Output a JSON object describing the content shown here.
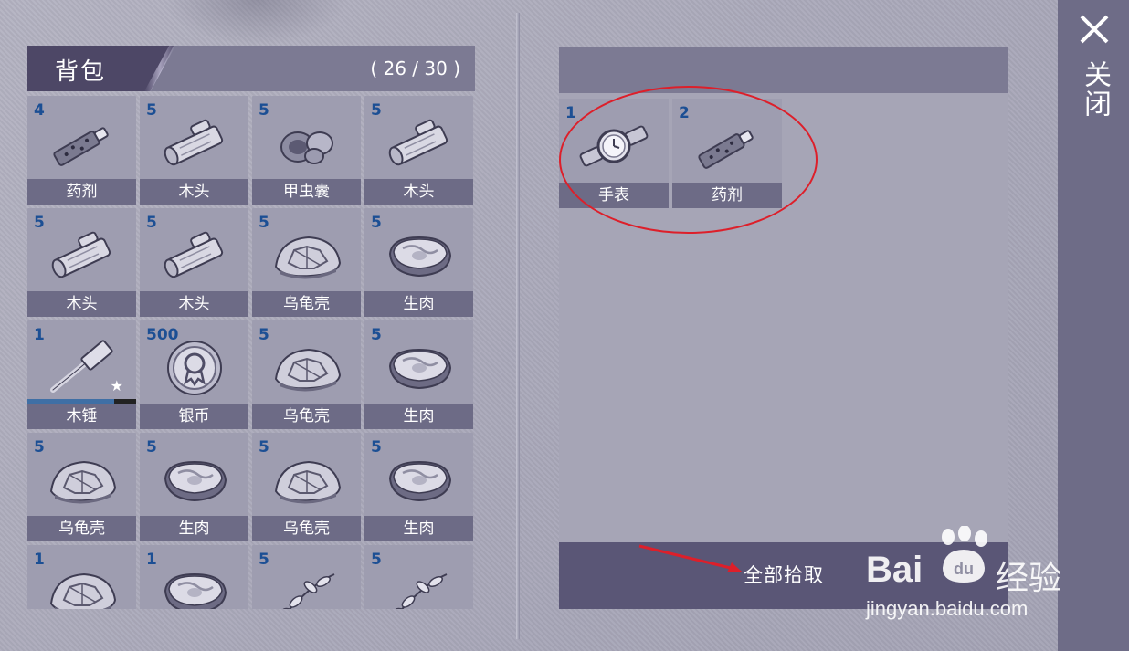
{
  "bag": {
    "title": "背包",
    "capacity": "( 26 / 30 )",
    "items": [
      {
        "qty": "4",
        "name": "药剂",
        "icon": "potion-icon"
      },
      {
        "qty": "5",
        "name": "木头",
        "icon": "log-icon"
      },
      {
        "qty": "5",
        "name": "甲虫囊",
        "icon": "beetle-sac-icon"
      },
      {
        "qty": "5",
        "name": "木头",
        "icon": "log-icon"
      },
      {
        "qty": "5",
        "name": "木头",
        "icon": "log-icon"
      },
      {
        "qty": "5",
        "name": "木头",
        "icon": "log-icon"
      },
      {
        "qty": "5",
        "name": "乌龟壳",
        "icon": "turtle-shell-icon"
      },
      {
        "qty": "5",
        "name": "生肉",
        "icon": "raw-meat-icon"
      },
      {
        "qty": "1",
        "name": "木锤",
        "icon": "hammer-icon",
        "durability": 0.8,
        "starred": true
      },
      {
        "qty": "500",
        "name": "银币",
        "icon": "silver-coin-icon"
      },
      {
        "qty": "5",
        "name": "乌龟壳",
        "icon": "turtle-shell-icon"
      },
      {
        "qty": "5",
        "name": "生肉",
        "icon": "raw-meat-icon"
      },
      {
        "qty": "5",
        "name": "乌龟壳",
        "icon": "turtle-shell-icon"
      },
      {
        "qty": "5",
        "name": "生肉",
        "icon": "raw-meat-icon"
      },
      {
        "qty": "5",
        "name": "乌龟壳",
        "icon": "turtle-shell-icon"
      },
      {
        "qty": "5",
        "name": "生肉",
        "icon": "raw-meat-icon"
      },
      {
        "qty": "1",
        "name": "",
        "icon": "turtle-shell-icon"
      },
      {
        "qty": "1",
        "name": "",
        "icon": "raw-meat-icon"
      },
      {
        "qty": "5",
        "name": "",
        "icon": "herb-icon"
      },
      {
        "qty": "5",
        "name": "",
        "icon": "herb-icon"
      }
    ]
  },
  "loot": {
    "title": "",
    "items": [
      {
        "qty": "1",
        "name": "手表",
        "icon": "watch-icon"
      },
      {
        "qty": "2",
        "name": "药剂",
        "icon": "potion-icon"
      }
    ],
    "pick_all_label": "全部拾取"
  },
  "close": {
    "label": "关闭",
    "icon": "close-icon"
  },
  "watermark": {
    "brand": "Bai",
    "brand_cn": "经验",
    "url": "jingyan.baidu.com"
  },
  "colors": {
    "quantity": "#1c4f94",
    "annotation": "#dd1f2a"
  }
}
